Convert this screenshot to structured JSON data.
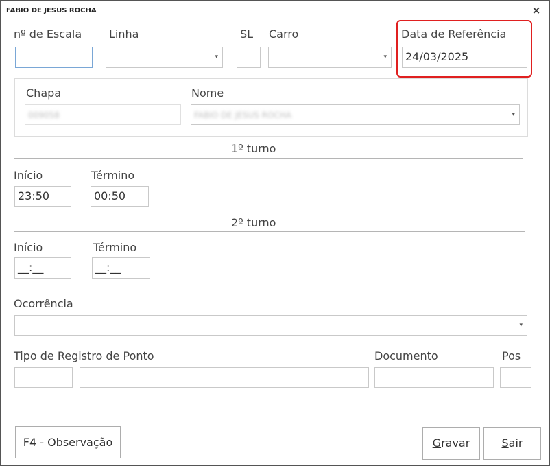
{
  "window": {
    "title": "FABIO DE JESUS ROCHA",
    "close_glyph": "×"
  },
  "fields": {
    "escala": {
      "label": "nº de Escala",
      "value": ""
    },
    "linha": {
      "label": "Linha",
      "value": ""
    },
    "sl": {
      "label": "SL",
      "value": ""
    },
    "carro": {
      "label": "Carro",
      "value": ""
    },
    "data_referencia": {
      "label": "Data de Referência",
      "value": "24/03/2025"
    }
  },
  "colaborador": {
    "chapa": {
      "label": "Chapa",
      "value": "009058"
    },
    "nome": {
      "label": "Nome",
      "value": "FABIO DE JESUS ROCHA"
    }
  },
  "turno1": {
    "title": "1º turno",
    "inicio": {
      "label": "Início",
      "value": "23:50"
    },
    "termino": {
      "label": "Término",
      "value": "00:50"
    }
  },
  "turno2": {
    "title": "2º turno",
    "inicio": {
      "label": "Início",
      "value": "__:__"
    },
    "termino": {
      "label": "Término",
      "value": "__:__"
    }
  },
  "ocorrencia": {
    "label": "Ocorrência",
    "value": ""
  },
  "registro": {
    "tipo_label": "Tipo de Registro de Ponto",
    "documento_label": "Documento",
    "pos_label": "Pos",
    "tipo_code": "",
    "tipo_desc": "",
    "documento": "",
    "pos": ""
  },
  "buttons": {
    "observacao": "F4 - Observação",
    "gravar_first": "G",
    "gravar_rest": "ravar",
    "sair_first": "S",
    "sair_rest": "air"
  },
  "colors": {
    "highlight": "#e02020",
    "focus_border": "#7aa7d6"
  },
  "icons": {
    "dropdown": "dropdown-arrow-icon",
    "close": "close-icon"
  }
}
